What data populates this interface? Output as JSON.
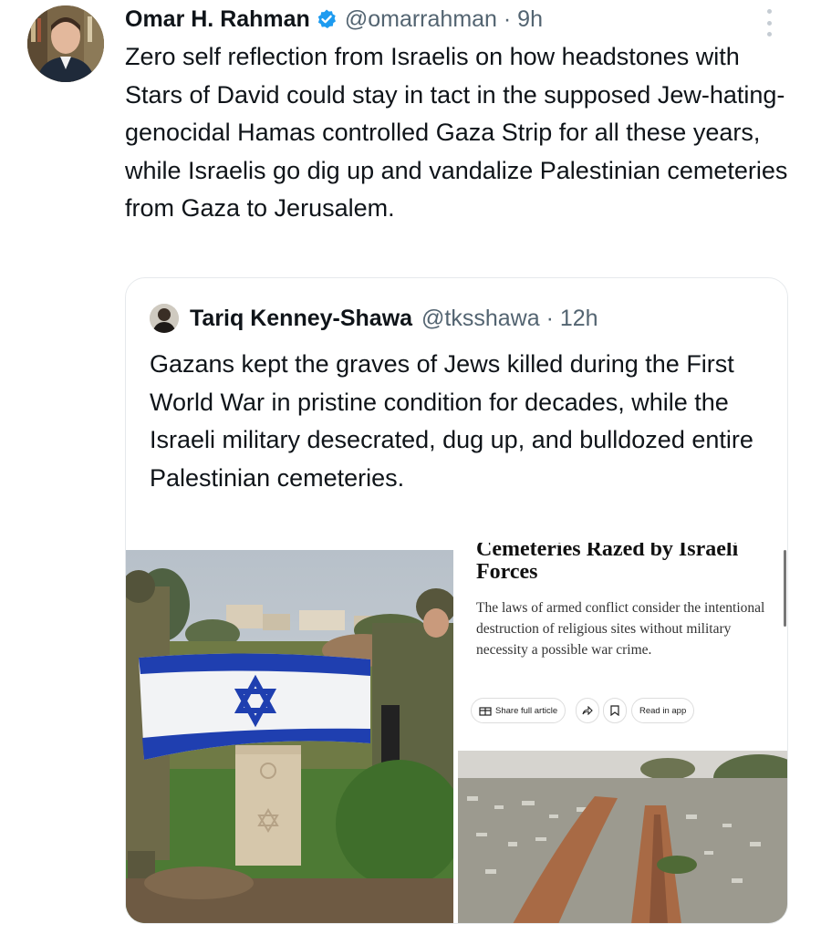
{
  "tweet": {
    "author_name": "Omar H. Rahman",
    "handle_time": "@omarrahman · 9h",
    "text": "Zero self reflection from Israelis on how headstones with Stars of David could stay in tact in the supposed Jew-hating-genocidal Hamas controlled Gaza Strip for all these years, while Israelis go dig up and vandalize Palestinian cemeteries from Gaza to Jerusalem.",
    "icons": [
      "avatar",
      "verified-badge-icon",
      "more-options-icon"
    ]
  },
  "quote": {
    "author_name": "Tariq Kenney-Shawa",
    "handle_time": "@tksshawa · 12h",
    "text": "Gazans kept the graves of Jews killed during the First World War in pristine condition for decades, while the Israeli military desecrated, dug up, and bulldozed entire Palestinian cemeteries.",
    "article": {
      "headline_line1": "Cemeteries Razed by Israeli",
      "headline_line2": "Forces",
      "body": "The laws of armed conflict consider the intentional destruction of religious sites without military necessity a possible war crime.",
      "share_label": "Share full article",
      "read_label": "Read in app"
    },
    "colors": {
      "flag_blue": "#1f3fb0",
      "verified_blue": "#1d9bf0"
    }
  }
}
